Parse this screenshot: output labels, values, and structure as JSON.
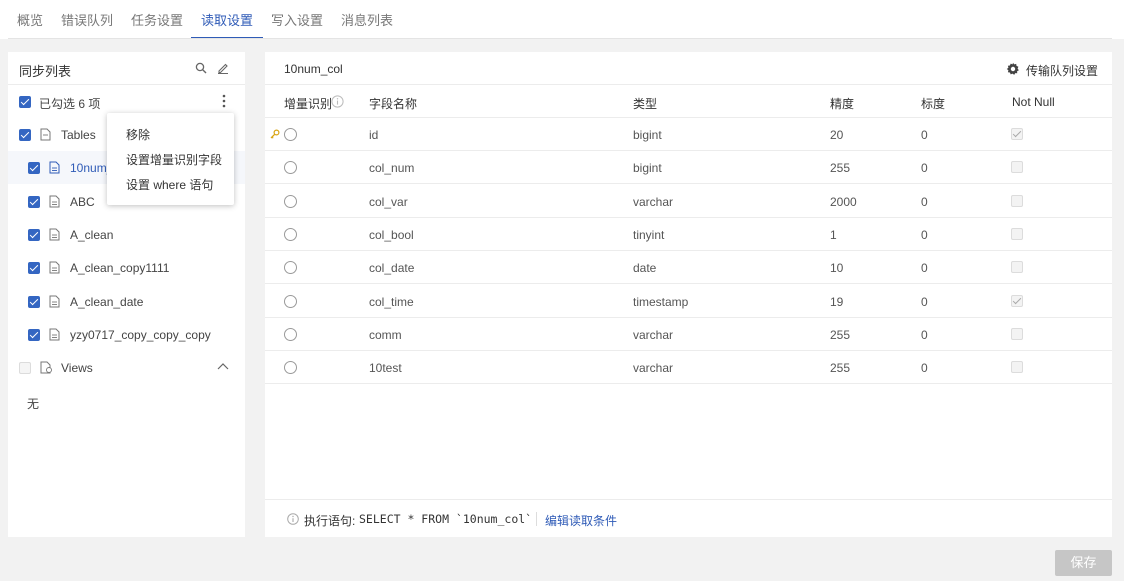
{
  "tabs": [
    {
      "label": "概览"
    },
    {
      "label": "错误队列"
    },
    {
      "label": "任务设置"
    },
    {
      "label": "读取设置",
      "active": true
    },
    {
      "label": "写入设置"
    },
    {
      "label": "消息列表"
    }
  ],
  "left_panel": {
    "title": "同步列表",
    "selected_count_label": "已勾选 6 项",
    "tables_group": {
      "label": "Tables",
      "checked": true
    },
    "tables": [
      {
        "label": "10num_col",
        "checked": true,
        "selected": true
      },
      {
        "label": "ABC",
        "checked": true
      },
      {
        "label": "A_clean",
        "checked": true
      },
      {
        "label": "A_clean_copy1111",
        "checked": true
      },
      {
        "label": "A_clean_date",
        "checked": true
      },
      {
        "label": "yzy0717_copy_copy_copy",
        "checked": true
      }
    ],
    "views_group": {
      "label": "Views",
      "checked": false
    },
    "views_empty": "无"
  },
  "context_menu": {
    "items": [
      "移除",
      "设置增量识别字段",
      "设置 where 语句"
    ]
  },
  "right_panel": {
    "title": "10num_col",
    "settings_label": "传输队列设置",
    "columns": [
      "增量识别",
      "字段名称",
      "类型",
      "精度",
      "标度",
      "Not Null"
    ],
    "rows": [
      {
        "name": "id",
        "type": "bigint",
        "precision": "20",
        "scale": "0",
        "not_null": true,
        "key": true
      },
      {
        "name": "col_num",
        "type": "bigint",
        "precision": "255",
        "scale": "0",
        "not_null": false
      },
      {
        "name": "col_var",
        "type": "varchar",
        "precision": "2000",
        "scale": "0",
        "not_null": false
      },
      {
        "name": "col_bool",
        "type": "tinyint",
        "precision": "1",
        "scale": "0",
        "not_null": false
      },
      {
        "name": "col_date",
        "type": "date",
        "precision": "10",
        "scale": "0",
        "not_null": false
      },
      {
        "name": "col_time",
        "type": "timestamp",
        "precision": "19",
        "scale": "0",
        "not_null": true
      },
      {
        "name": "comm",
        "type": "varchar",
        "precision": "255",
        "scale": "0",
        "not_null": false
      },
      {
        "name": "10test",
        "type": "varchar",
        "precision": "255",
        "scale": "0",
        "not_null": false
      }
    ],
    "footer": {
      "exec_label": "执行语句:",
      "sql": "SELECT * FROM `10num_col`",
      "edit_link": "编辑读取条件"
    }
  },
  "save_label": "保存",
  "colors": {
    "accent": "#2f5bb7",
    "checkbox": "#3466c2",
    "disabled_button": "#c6c6c6"
  }
}
